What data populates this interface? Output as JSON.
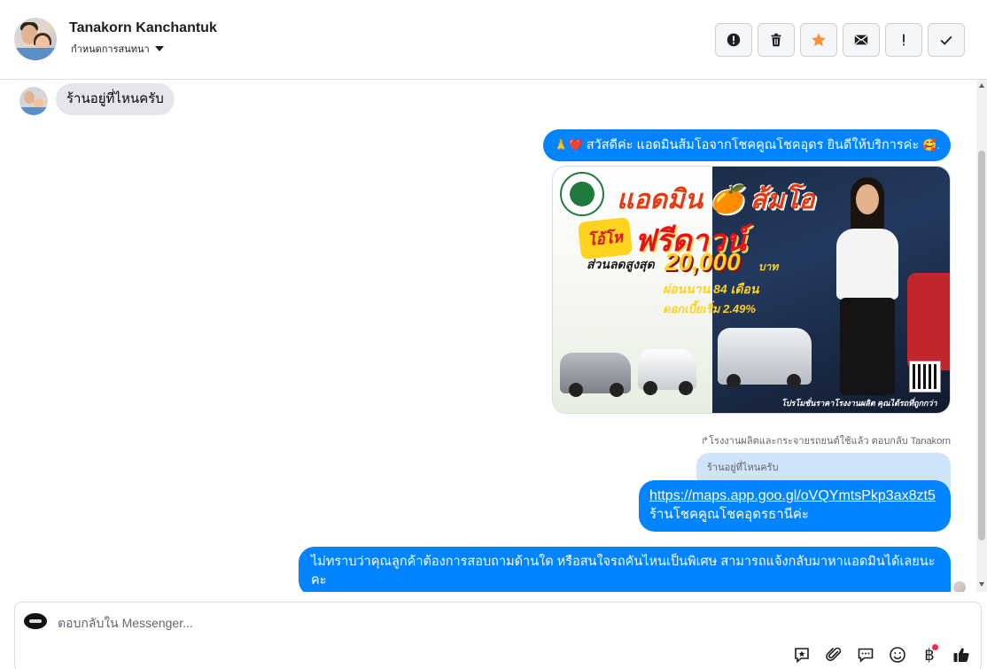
{
  "header": {
    "contact_name": "Tanakorn Kanchantuk",
    "assign_label": "กำหนดการสนทนา",
    "toolbar": [
      {
        "name": "report-icon",
        "title": "report"
      },
      {
        "name": "trash-icon",
        "title": "delete"
      },
      {
        "name": "star-icon",
        "title": "star"
      },
      {
        "name": "envelope-icon",
        "title": "mark unread"
      },
      {
        "name": "exclamation-icon",
        "title": "follow up"
      },
      {
        "name": "checkmark-icon",
        "title": "done"
      }
    ],
    "colors": {
      "star": "#f7923a"
    }
  },
  "thread": {
    "incoming_message": "ร้านอยู่ที่ไหนครับ",
    "greeting": {
      "emoji": "🙏❤️",
      "text": "สวัสดีค่ะ แอดมินส้มโอจากโชคคูณโชคอุดร ยินดีให้บริการค่ะ",
      "trailing_emoji": "🥰."
    },
    "promo_image": {
      "headline": "แอดมิน 🍊 ส้มโอ",
      "burst": "โอ้โห",
      "free": "ฟรีดาวน์",
      "discount_label": "ส่วนลดสูงสุด",
      "amount": "20,000",
      "currency": "บาท",
      "installment": "ผ่อนนาน 84 เดือน",
      "interest": "ดอกเบี้ยเริ่ม 2.49%",
      "footer": "โปรโมชั่นราคาโรงงานผลิต คุณได้รถที่ถูกกว่า"
    },
    "reply_meta": "↱โรงงานผลิตและกระจายรถยนต์ใช้แล้ว ตอบกลับ Tanakorn",
    "quoted_text": "ร้านอยู่ที่ไหนครับ",
    "link_message": {
      "url": "https://maps.app.goo.gl/oVQYmtsPkp3ax8zt5",
      "text": "ร้านโชคคูณโชคอุดรธานีค่ะ"
    },
    "long_message": "ไม่ทราบว่าคุณลูกค้าต้องการสอบถามด้านใด หรือสนใจรถคันไหนเป็นพิเศษ สามารถแจ้งกลับมาหาแอดมินได้เลยนะคะ",
    "colors": {
      "outgoing": "#0084ff",
      "incoming": "#e4e6eb"
    }
  },
  "composer": {
    "placeholder": "ตอบกลับใน Messenger...",
    "tools": [
      "saved-reply-icon",
      "paperclip-icon",
      "chat-bubble-icon",
      "emoji-icon",
      "baht-icon",
      "thumbs-up-icon"
    ],
    "baht_symbol": "฿"
  }
}
